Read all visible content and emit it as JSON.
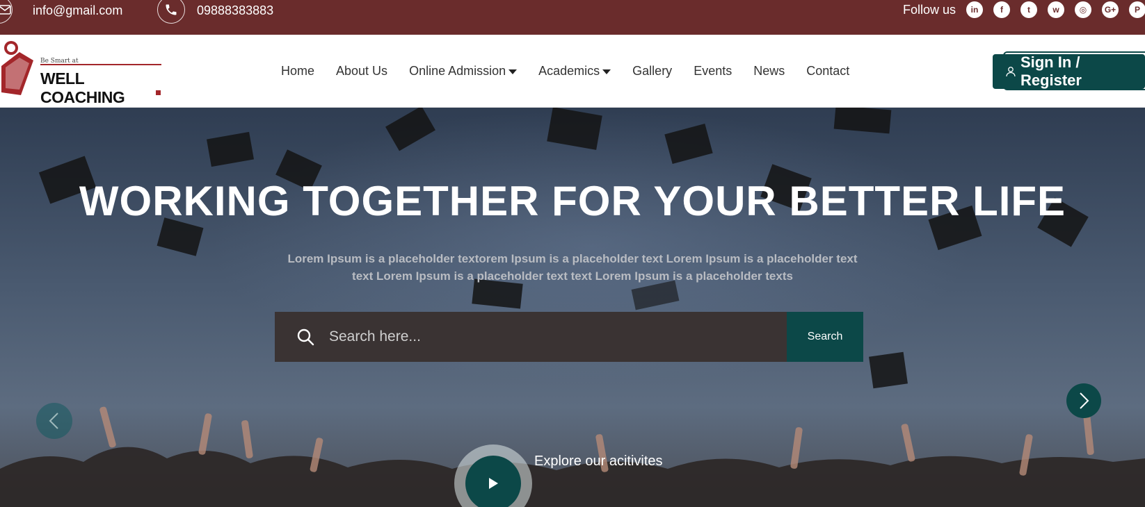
{
  "topbar": {
    "email": "info@gmail.com",
    "phone": "09888383883",
    "follow_label": "Follow us",
    "socials": [
      {
        "icon": "linkedin-icon",
        "glyph": "in"
      },
      {
        "icon": "facebook-icon",
        "glyph": "f"
      },
      {
        "icon": "twitter-icon",
        "glyph": "t"
      },
      {
        "icon": "whatsapp-icon",
        "glyph": "w"
      },
      {
        "icon": "instagram-icon",
        "glyph": "◎"
      },
      {
        "icon": "google-plus-icon",
        "glyph": "G+"
      },
      {
        "icon": "pinterest-icon",
        "glyph": "P"
      }
    ]
  },
  "header": {
    "logo_tagline": "Be Smart at",
    "logo_name": "WELL COACHING",
    "nav": [
      {
        "label": "Home",
        "dropdown": false
      },
      {
        "label": "About Us",
        "dropdown": false
      },
      {
        "label": "Online Admission",
        "dropdown": true
      },
      {
        "label": "Academics",
        "dropdown": true
      },
      {
        "label": "Gallery",
        "dropdown": false
      },
      {
        "label": "Events",
        "dropdown": false
      },
      {
        "label": "News",
        "dropdown": false
      },
      {
        "label": "Contact",
        "dropdown": false
      }
    ],
    "signin_label": "Sign In / Register"
  },
  "hero": {
    "title": "WORKING TOGETHER FOR YOUR BETTER LIFE",
    "subtitle_line1": "Lorem Ipsum is a placeholder textorem Ipsum is a placeholder text Lorem Ipsum is a placeholder text",
    "subtitle_line2": "text Lorem Ipsum is a placeholder text text Lorem Ipsum is a placeholder texts",
    "search_placeholder": "Search here...",
    "search_button": "Search",
    "explore_label": "Explore our acitivites"
  },
  "colors": {
    "topbar_bg": "#6a2c2c",
    "accent": "#0c4848",
    "logo_red": "#a3262a"
  }
}
